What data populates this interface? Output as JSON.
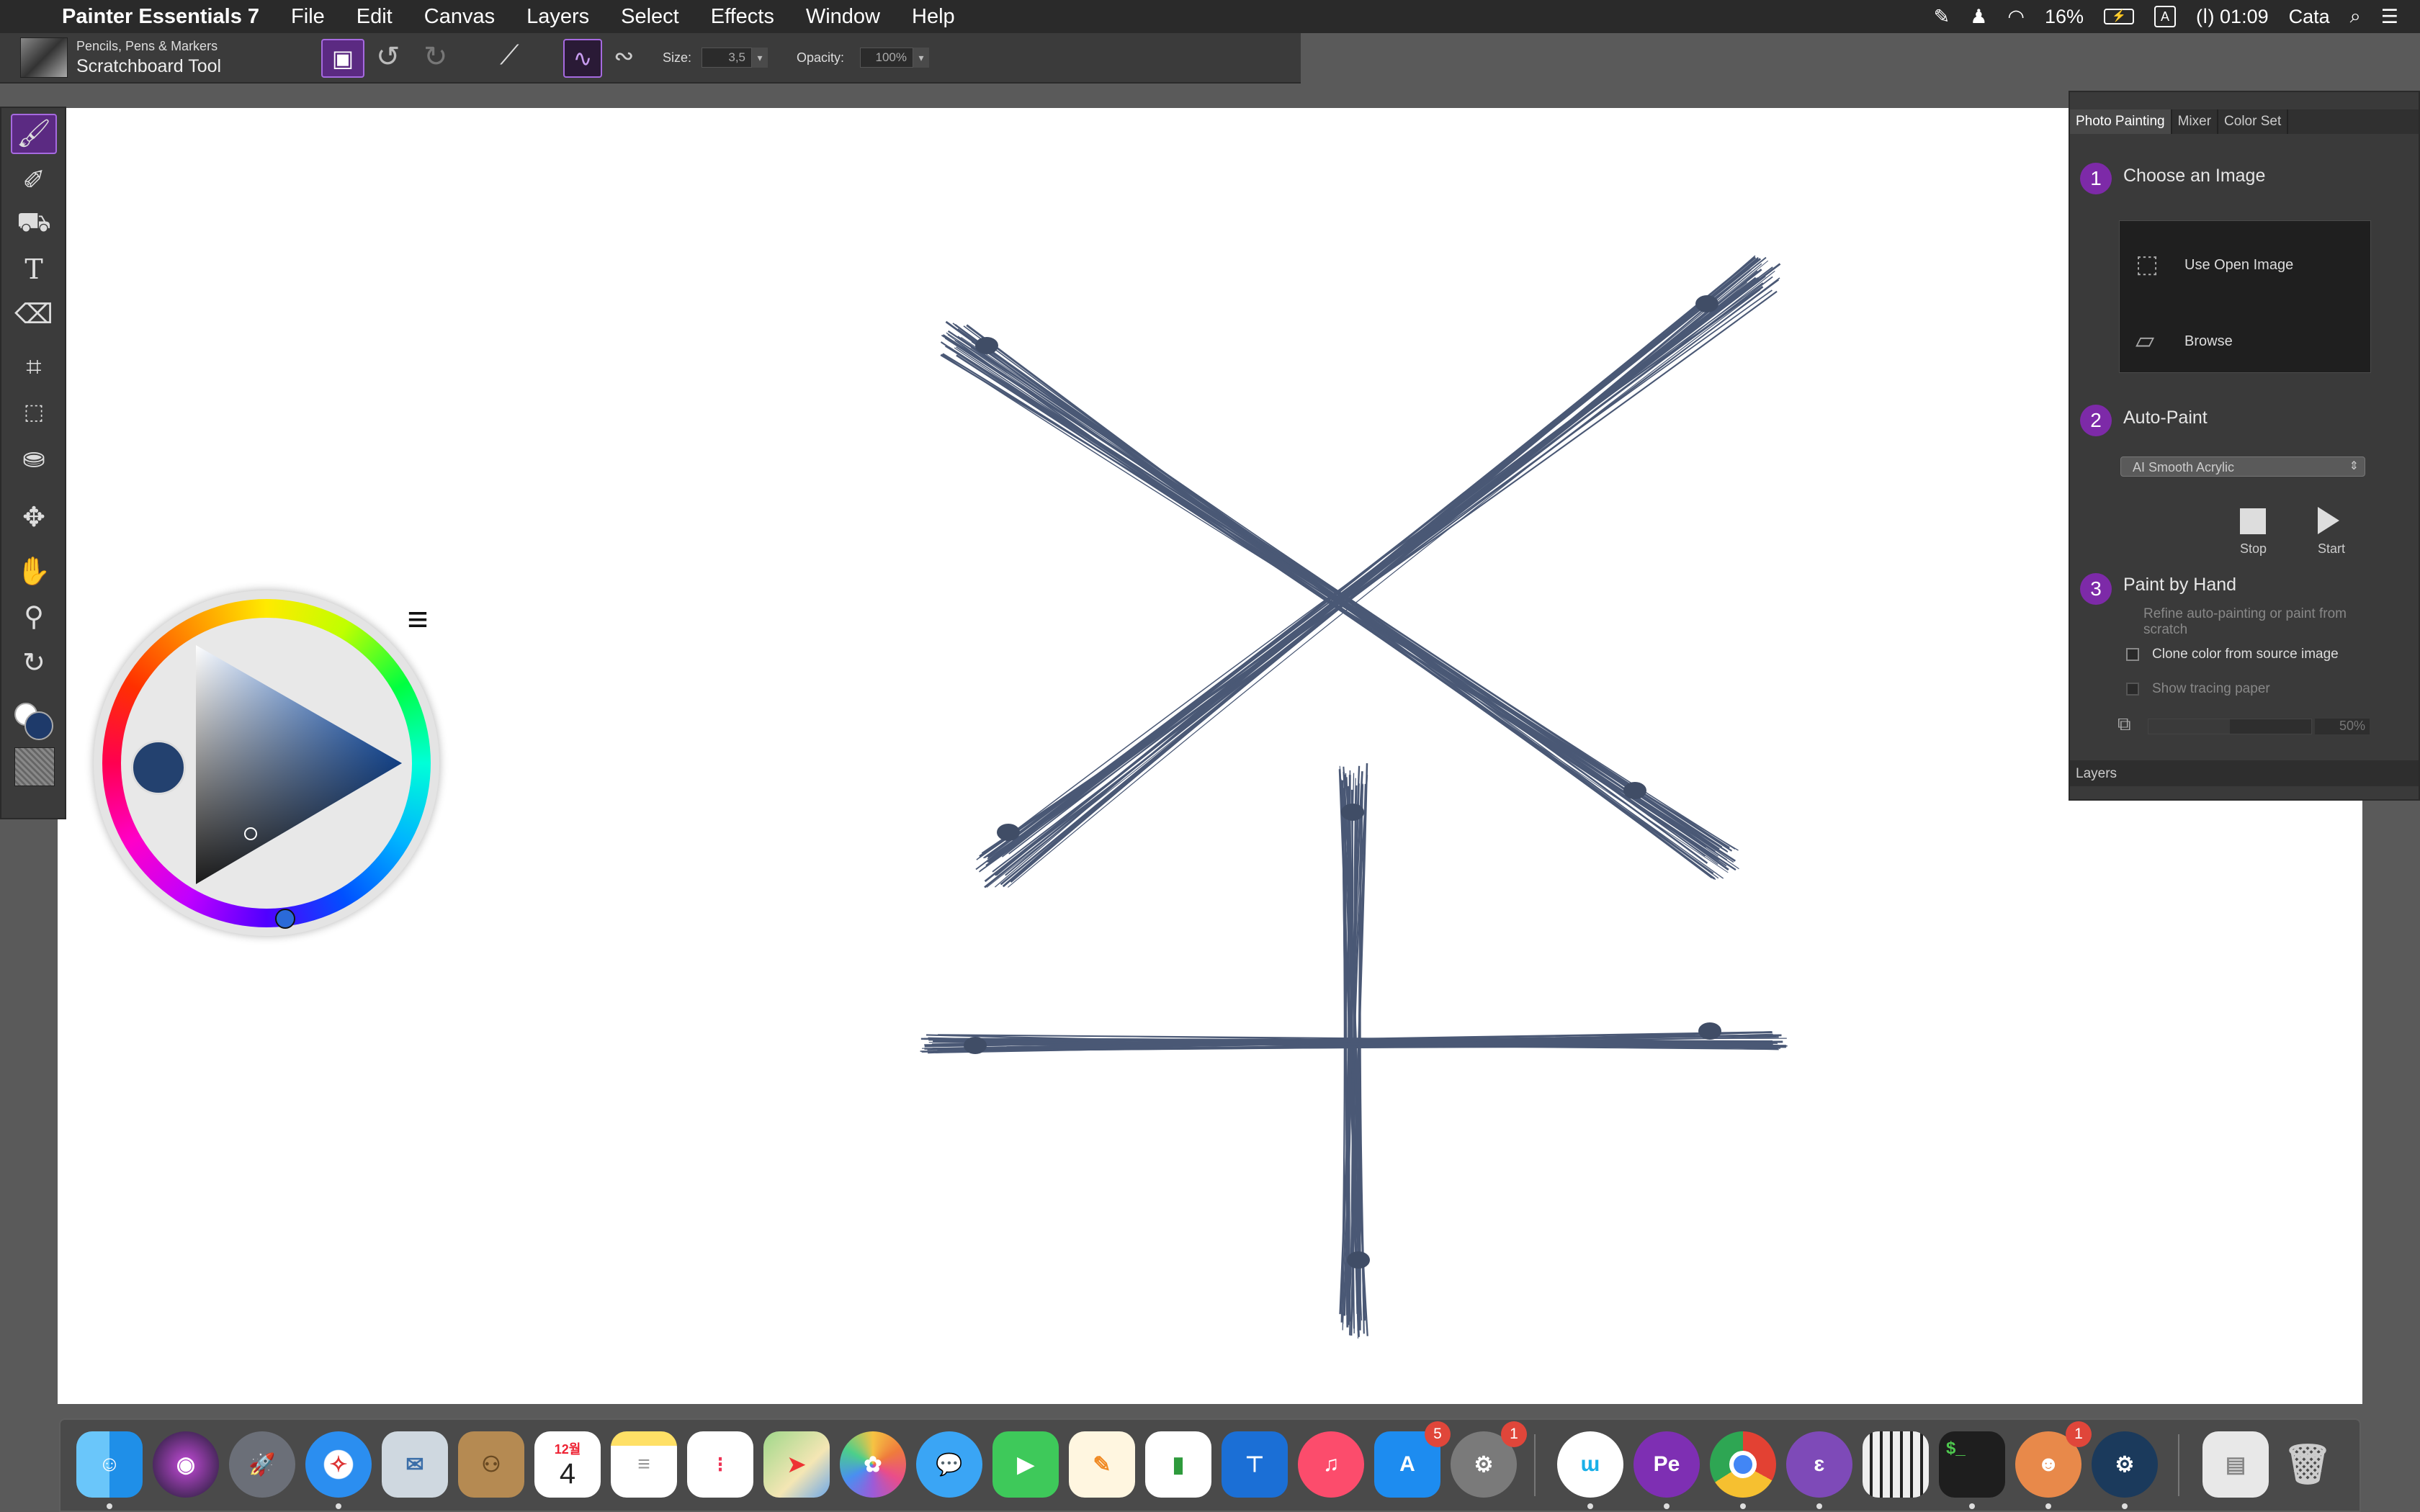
{
  "menubar": {
    "app_name": "Painter Essentials 7",
    "items": [
      "File",
      "Edit",
      "Canvas",
      "Layers",
      "Select",
      "Effects",
      "Window",
      "Help"
    ],
    "battery": "16%",
    "input_source": "A",
    "clock": "(ا) 01:09",
    "user": "Cata"
  },
  "toolbar": {
    "brush_category": "Pencils, Pens & Markers",
    "brush_variant": "Scratchboard Tool",
    "size_label": "Size:",
    "size_value": "3,5",
    "opacity_label": "Opacity:",
    "opacity_value": "100%"
  },
  "toolbox": {
    "tools": [
      "brush-tool",
      "dropper-tool",
      "paint-bucket-tool",
      "text-tool",
      "eraser-tool",
      "crop-tool",
      "rectangle-select-tool",
      "clone-stamp-tool",
      "transform-tool",
      "grabber-tool",
      "magnifier-tool",
      "rotate-page-tool"
    ],
    "main_color": "#1e3a6a",
    "secondary_color": "#ffffff"
  },
  "color_wheel": {
    "current_color": "#23416f"
  },
  "panel": {
    "tabs": [
      "Photo Painting",
      "Mixer",
      "Color Set"
    ],
    "step1": {
      "num": "1",
      "title": "Choose an Image",
      "use_open": "Use Open Image",
      "browse": "Browse"
    },
    "step2": {
      "num": "2",
      "title": "Auto-Paint",
      "preset": "AI Smooth Acrylic",
      "stop": "Stop",
      "start": "Start"
    },
    "step3": {
      "num": "3",
      "title": "Paint by Hand",
      "hint": "Refine auto-painting or paint from scratch",
      "clone_label": "Clone color from source image",
      "tracing_label": "Show tracing paper",
      "tracing_pct": "50%"
    },
    "layers_tab": "Layers"
  },
  "dock": {
    "app_store_badge": "5",
    "prefs_badge": "1",
    "game_badge": "1",
    "calendar_month": "12월",
    "calendar_day": "4"
  },
  "colors": {
    "accent": "#7d2aa8",
    "ink": "#2b3c5e"
  }
}
